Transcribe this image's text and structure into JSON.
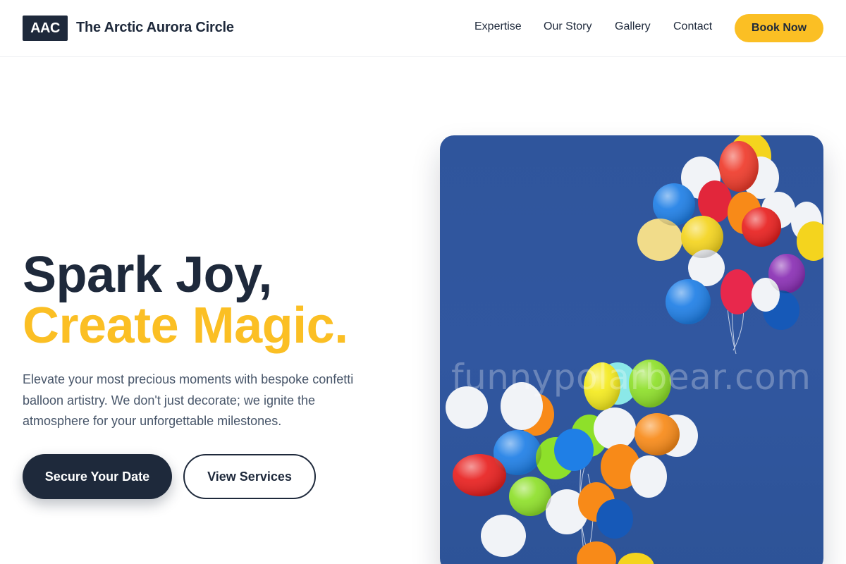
{
  "nav": {
    "logo": "AAC",
    "brand": "The Arctic Aurora Circle",
    "links": [
      "Expertise",
      "Our Story",
      "Gallery",
      "Contact"
    ],
    "cta": "Book Now"
  },
  "hero": {
    "headline_line1": "Spark Joy,",
    "headline_line2": "Create Magic.",
    "description": "Elevate your most precious moments with bespoke confetti balloon artistry. We don't just decorate; we ignite the atmosphere for your unforgettable milestones.",
    "primary_button": "Secure Your Date",
    "secondary_button": "View Services"
  },
  "image": {
    "watermark": "funnypolarbear.com",
    "subject": "balloon-bunches-photo"
  },
  "colors": {
    "navy": "#1e293b",
    "accent_yellow": "#fbbf24",
    "body_text": "#475569",
    "sky_blue": "#2f559c"
  }
}
